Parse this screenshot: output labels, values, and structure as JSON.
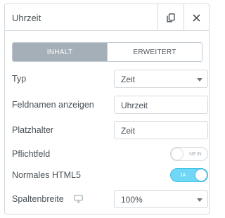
{
  "header": {
    "title": "Uhrzeit",
    "duplicate_icon": "duplicate-icon",
    "close_icon": "close-icon"
  },
  "tabs": [
    {
      "label": "INHALT",
      "active": true
    },
    {
      "label": "ERWEITERT",
      "active": false
    }
  ],
  "fields": {
    "typ": {
      "label": "Typ",
      "value": "Zeit"
    },
    "feldnamen": {
      "label": "Feldnamen anzeigen",
      "value": "Uhrzeit"
    },
    "platzhalter": {
      "label": "Platzhalter",
      "value": "Zeit"
    },
    "pflichtfeld": {
      "label": "Pflichtfeld",
      "toggle_text": "NEIN",
      "on": false
    },
    "html5": {
      "label": "Normales HTML5",
      "toggle_text": "JA",
      "on": true
    },
    "spaltenbreite": {
      "label": "Spaltenbreite",
      "value": "100%",
      "icon": "desktop-icon"
    }
  },
  "colors": {
    "toggle_on": "#71d7f7",
    "tab_active": "#a4afb7",
    "border": "#d5dadf"
  }
}
